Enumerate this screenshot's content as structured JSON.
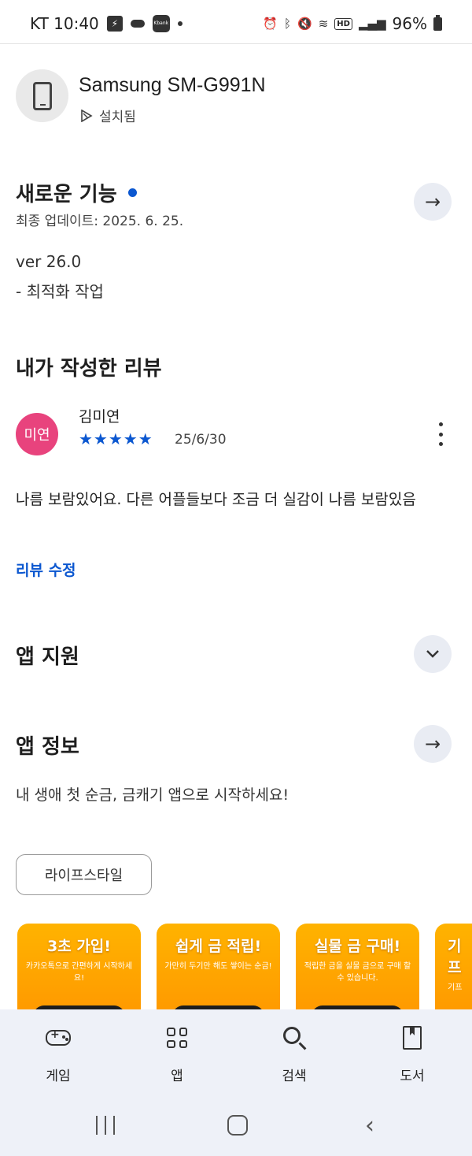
{
  "status_bar": {
    "carrier_time": "KT 10:40",
    "battery": "96%",
    "kbank_label": "Kbank",
    "hd_label": "HD"
  },
  "device": {
    "name": "Samsung SM-G991N",
    "installed_label": "설치됨"
  },
  "whats_new": {
    "title": "새로운 기능",
    "updated": "최종 업데이트: 2025. 6. 25.",
    "version": "ver 26.0",
    "change": "- 최적화 작업"
  },
  "my_review": {
    "title": "내가 작성한 리뷰",
    "avatar_text": "미연",
    "reviewer_name": "김미연",
    "rating": 5,
    "stars": "★★★★★",
    "date": "25/6/30",
    "body": "나름 보람있어요. 다른 어플들보다 조금 더 실감이 나름 보람있음",
    "edit_label": "리뷰 수정"
  },
  "app_support": {
    "title": "앱 지원"
  },
  "app_info": {
    "title": "앱 정보",
    "description": "내 생애 첫 순금, 금캐기 앱으로 시작하세요!",
    "tag": "라이프스타일"
  },
  "screenshots": [
    {
      "title": "3초 가입!",
      "sub": "카카오톡으로 간편하게 시작하세요!"
    },
    {
      "title": "쉽게 금 적립!",
      "sub": "가만히 두기만 해도 쌓이는 순금!"
    },
    {
      "title": "실물 금 구매!",
      "sub": "적립한 금을 실물 금으로 구매 할 수 있습니다."
    },
    {
      "title": "기프",
      "sub": "기프"
    }
  ],
  "bottom_nav": {
    "items": [
      {
        "label": "게임",
        "icon": "gamepad-icon"
      },
      {
        "label": "앱",
        "icon": "apps-grid-icon"
      },
      {
        "label": "검색",
        "icon": "search-icon"
      },
      {
        "label": "도서",
        "icon": "book-icon"
      }
    ]
  },
  "colors": {
    "accent_blue": "#0b57d0",
    "avatar_pink": "#e8437d",
    "nav_bg": "#eef1f8",
    "screenshot_orange": "#ffa000"
  }
}
